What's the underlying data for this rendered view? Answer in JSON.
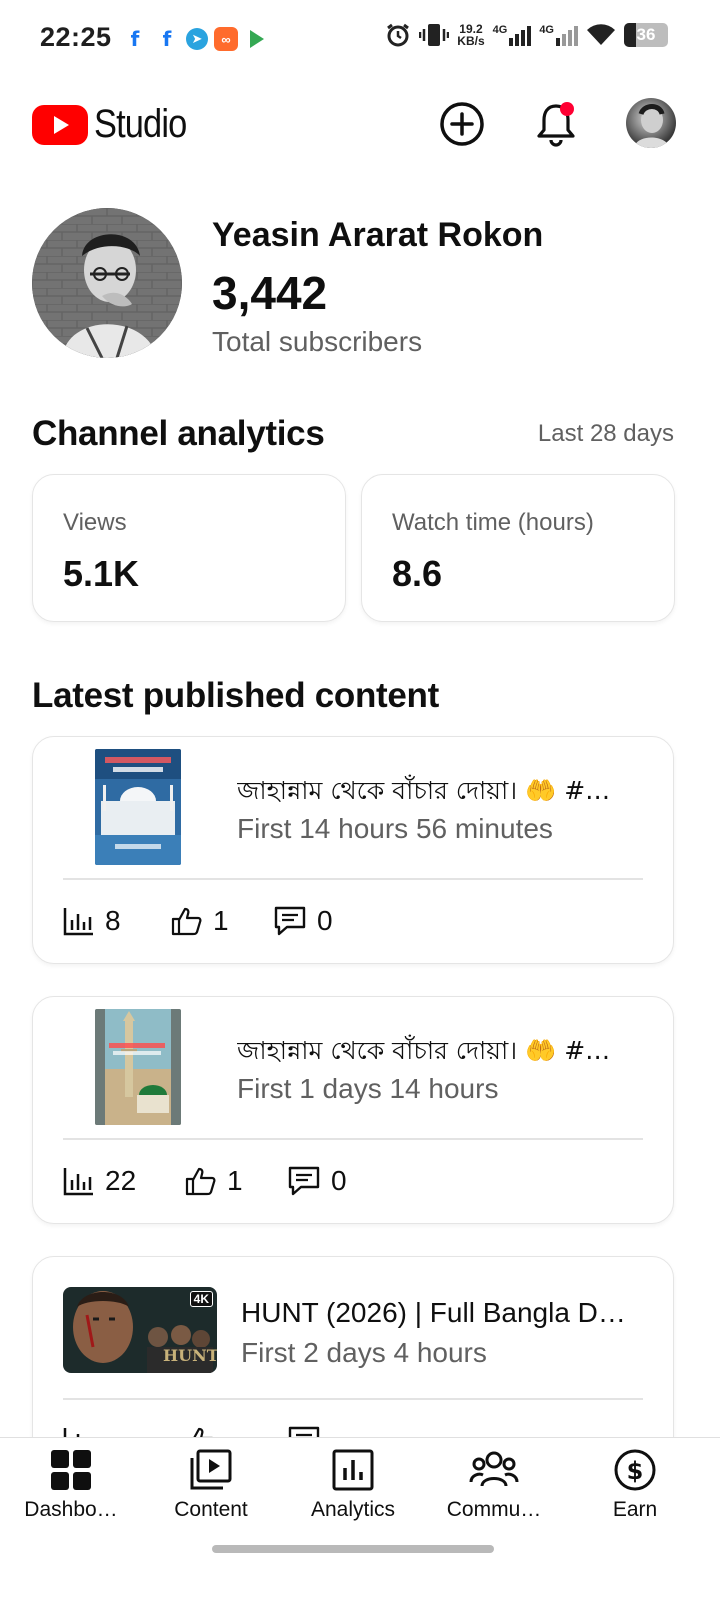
{
  "status_bar": {
    "time": "22:25",
    "speed_value": "19.2",
    "speed_unit": "KB/s",
    "net1": "4G",
    "net2": "4G",
    "battery": "36",
    "notification_apps": [
      "facebook-icon",
      "facebook-icon",
      "telegram-icon",
      "kwai-icon",
      "play-store-icon"
    ],
    "status_icons": [
      "alarm-icon",
      "vibrate-icon",
      "wifi-icon",
      "battery-icon"
    ]
  },
  "header": {
    "logo_text": "Studio",
    "brand_color": "#ff0000",
    "notification_dot_color": "#ff0033"
  },
  "channel": {
    "name": "Yeasin Ararat Rokon",
    "subscribers": "3,442",
    "subscribers_label": "Total subscribers"
  },
  "analytics": {
    "title": "Channel analytics",
    "period": "Last 28 days",
    "views_label": "Views",
    "views_value": "5.1K",
    "watch_label": "Watch time (hours)",
    "watch_value": "8.6"
  },
  "latest": {
    "title": "Latest published content",
    "items": [
      {
        "title": "জাহান্নাম থেকে বাঁচার দোয়া। 🤲 #…",
        "subtitle": "First 14 hours 56 minutes",
        "views": "8",
        "likes": "1",
        "comments": "0"
      },
      {
        "title": "জাহান্নাম থেকে বাঁচার দোয়া। 🤲 #…",
        "subtitle": "First 1 days 14 hours",
        "views": "22",
        "likes": "1",
        "comments": "0"
      },
      {
        "title": "HUNT (2026) | Full Bangla D…",
        "subtitle": "First 2 days 4 hours",
        "views": "",
        "likes": "",
        "comments": "",
        "badge": "4K"
      }
    ]
  },
  "bottom_nav": {
    "dashboard": "Dashbo…",
    "content": "Content",
    "analytics": "Analytics",
    "community": "Commu…",
    "earn": "Earn"
  }
}
